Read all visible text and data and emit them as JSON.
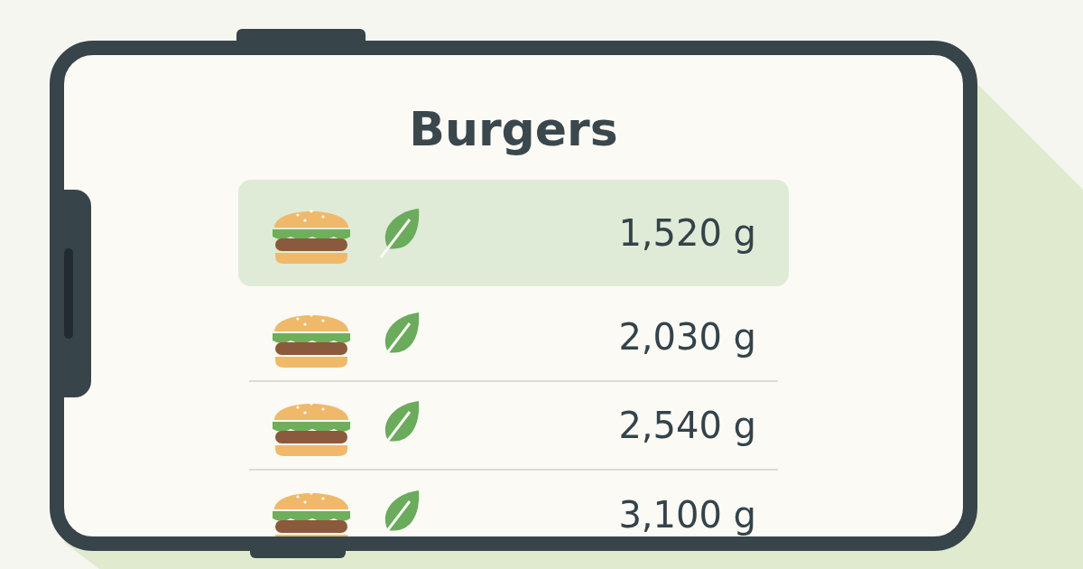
{
  "screen": {
    "title": "Burgers"
  },
  "rows": [
    {
      "weight": "1,520 g",
      "selected": true
    },
    {
      "weight": "2,030 g",
      "selected": false
    },
    {
      "weight": "2,540 g",
      "selected": false
    },
    {
      "weight": "3,100 g",
      "selected": false
    }
  ]
}
